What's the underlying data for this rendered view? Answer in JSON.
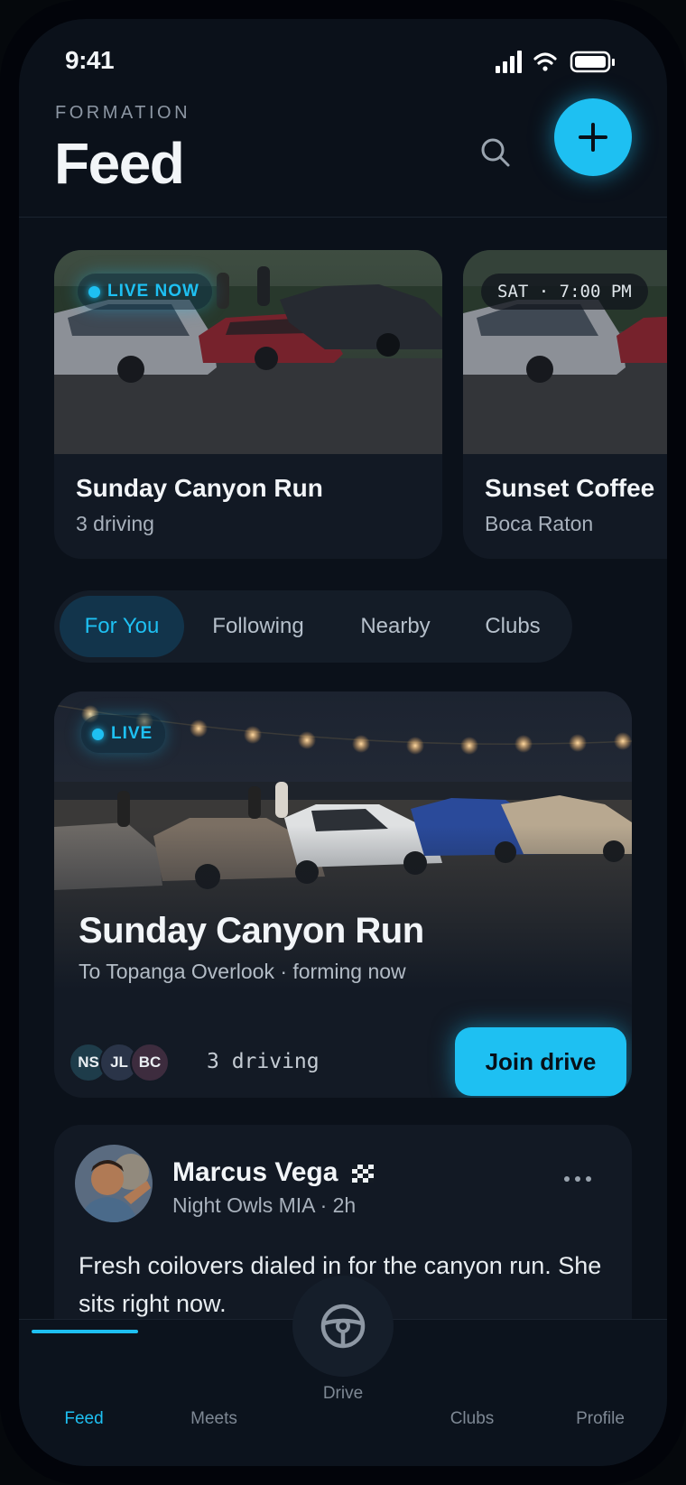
{
  "status": {
    "time": "9:41"
  },
  "header": {
    "brand": "FORMATION",
    "title": "Feed"
  },
  "meets": [
    {
      "badge": "LIVE NOW",
      "title": "Sunday Canyon Run",
      "subtitle": "3 driving"
    },
    {
      "badge": "SAT · 7:00 PM",
      "title": "Sunset Coffee",
      "subtitle": "Boca Raton"
    }
  ],
  "tabs": [
    {
      "label": "For You",
      "active": true
    },
    {
      "label": "Following"
    },
    {
      "label": "Nearby"
    },
    {
      "label": "Clubs"
    }
  ],
  "featured": {
    "badge": "LIVE",
    "title": "Sunday Canyon Run",
    "subtitle": "To Topanga Overlook · forming now",
    "participants": [
      "NS",
      "JL",
      "BC"
    ],
    "driving_count": "3 driving",
    "join_label": "Join drive"
  },
  "post": {
    "author": "Marcus Vega",
    "meta": "Night Owls MIA · 2h",
    "text": "Fresh coilovers dialed in for the canyon run. She sits right now."
  },
  "nav": {
    "feed": "Feed",
    "meets": "Meets",
    "drive": "Drive",
    "clubs": "Clubs",
    "profile": "Profile"
  },
  "colors": {
    "accent": "#1ec0f2",
    "background": "#0b111a",
    "card": "#121924"
  },
  "icons": {
    "search": "search-icon",
    "add": "plus-icon",
    "more": "more-horizontal-icon",
    "drive": "steering-wheel-icon",
    "badge": "checkered-flag-icon"
  }
}
